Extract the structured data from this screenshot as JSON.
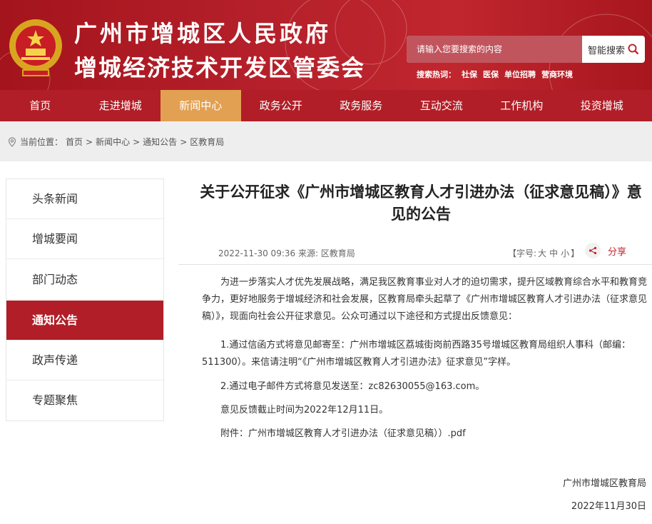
{
  "header": {
    "title_line1": "广州市增城区人民政府",
    "title_line2": "增城经济技术开发区管委会",
    "search_placeholder": "请输入您要搜索的内容",
    "search_button": "智能搜索",
    "hot_label": "搜索热词：",
    "hot_words": [
      "社保",
      "医保",
      "单位招聘",
      "营商环境"
    ]
  },
  "nav": {
    "items": [
      "首页",
      "走进增城",
      "新闻中心",
      "政务公开",
      "政务服务",
      "互动交流",
      "工作机构",
      "投资增城"
    ],
    "active_index": 2
  },
  "breadcrumb": {
    "label": "当前位置：",
    "items": [
      "首页",
      "新闻中心",
      "通知公告",
      "区教育局"
    ],
    "separator": ">"
  },
  "sidebar": {
    "items": [
      "头条新闻",
      "增城要闻",
      "部门动态",
      "通知公告",
      "政声传递",
      "专题聚焦"
    ],
    "active_index": 3
  },
  "article": {
    "title": "关于公开征求《广州市增城区教育人才引进办法（征求意见稿）》意见的公告",
    "meta": "2022-11-30 09:36 来源: 区教育局",
    "fontsize_label": "【字号:",
    "fontsize_options": [
      "大",
      "中",
      "小"
    ],
    "fontsize_end": "】",
    "share_label": "分享",
    "paragraphs": [
      "为进一步落实人才优先发展战略，满足我区教育事业对人才的迫切需求，提升区域教育综合水平和教育竞争力，更好地服务于增城经济和社会发展，区教育局牵头起草了《广州市增城区教育人才引进办法（征求意见稿）》，现面向社会公开征求意见。公众可通过以下途径和方式提出反馈意见：",
      "1.通过信函方式将意见邮寄至：广州市增城区荔城街岗前西路35号增城区教育局组织人事科（邮编：511300）。来信请注明“《广州市增城区教育人才引进办法》征求意见”字样。",
      "2.通过电子邮件方式将意见发送至：zc82630055@163.com。",
      "意见反馈截止时间为2022年12月11日。",
      "附件：广州市增城区教育人才引进办法（征求意见稿））.pdf"
    ],
    "signature": "广州市增城区教育局",
    "date": "2022年11月30日"
  },
  "colors": {
    "header_red": "#b11e27",
    "nav_active": "#e2a052",
    "share_red": "#c0262e"
  }
}
